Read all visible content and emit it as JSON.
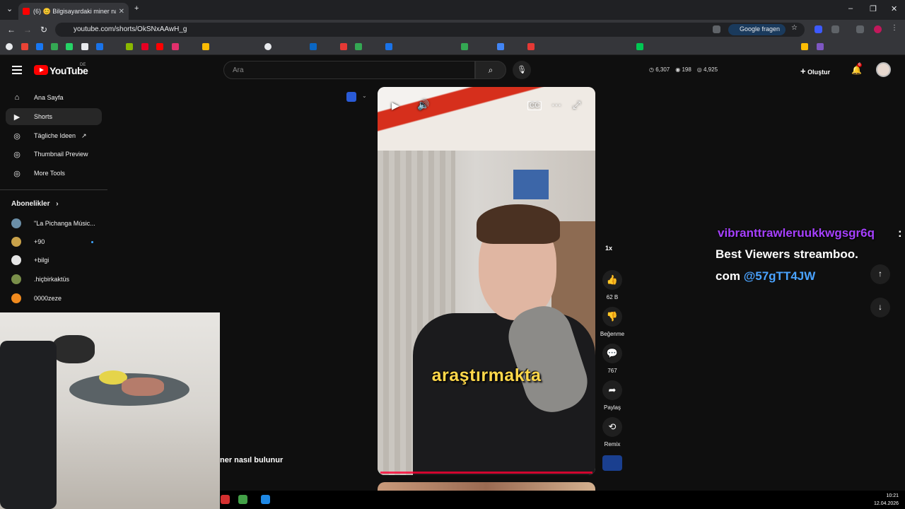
{
  "browser": {
    "tab_title": "(6) 😊 Bilgisayardaki miner nası",
    "url": "youtube.com/shorts/OkSNxAAwH_g",
    "google_fragen": "Google fragen"
  },
  "youtube": {
    "logo_text": "YouTube",
    "country": "DE",
    "search_placeholder": "Ara",
    "stats": {
      "a": "6,307",
      "b": "198",
      "c": "4,925"
    },
    "create_label": "Oluştur",
    "notifications": "6"
  },
  "sidebar": {
    "items": [
      {
        "label": "Ana Sayfa",
        "icon": "home-icon"
      },
      {
        "label": "Shorts",
        "icon": "shorts-icon"
      },
      {
        "label": "Tägliche Ideen",
        "icon": "extension-icon"
      },
      {
        "label": "Thumbnail Preview",
        "icon": "extension-icon"
      },
      {
        "label": "More Tools",
        "icon": "extension-icon"
      }
    ],
    "subscriptions_heading": "Abonelikler",
    "subscriptions": [
      {
        "label": "\"La Pichanga Músic...",
        "color": "#6b8fa8"
      },
      {
        "label": "+90",
        "color": "#c9a24a"
      },
      {
        "label": "+bilgi",
        "color": "#e6e6e6"
      },
      {
        "label": ".hiçbirkaktüs",
        "color": "#7a8f4a"
      },
      {
        "label": "0000zeze",
        "color": "#f08a1e"
      }
    ]
  },
  "video": {
    "caption": "araştırmakta",
    "title_fragment": "ner nasıl bulunur"
  },
  "actions": {
    "speed": "1x",
    "likes": "62 B",
    "dislike_label": "Beğenme",
    "comments": "767",
    "share_label": "Paylaş",
    "remix_label": "Remix"
  },
  "chat": {
    "user": "vibranttrawleruukkwgsgr6q",
    "colon": ":",
    "line1": "Best Viewers streamboo.",
    "line2_prefix": "com ",
    "line2_mention": "@57gTT4JW"
  },
  "taskbar": {
    "time": "10:21",
    "date": "12.04.2026"
  }
}
